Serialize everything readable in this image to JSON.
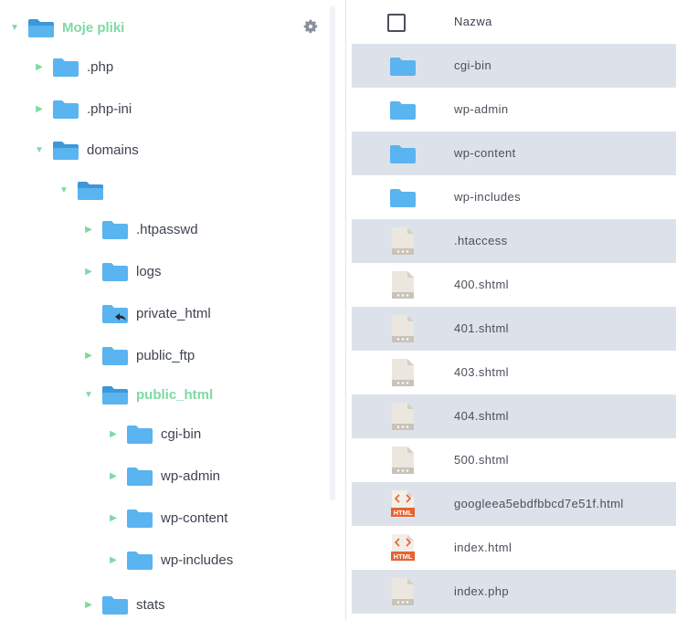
{
  "tree": {
    "root_label": "Moje pliki",
    "items": [
      {
        "label": ".php"
      },
      {
        "label": ".php-ini"
      },
      {
        "label": "domains"
      },
      {
        "label": ""
      },
      {
        "label": ".htpasswd"
      },
      {
        "label": "logs"
      },
      {
        "label": "private_html"
      },
      {
        "label": "public_ftp"
      },
      {
        "label": "public_html"
      },
      {
        "label": "cgi-bin"
      },
      {
        "label": "wp-admin"
      },
      {
        "label": "wp-content"
      },
      {
        "label": "wp-includes"
      },
      {
        "label": "stats"
      }
    ]
  },
  "list": {
    "column_name": "Nazwa",
    "files": [
      {
        "name": "cgi-bin",
        "type": "folder"
      },
      {
        "name": "wp-admin",
        "type": "folder"
      },
      {
        "name": "wp-content",
        "type": "folder"
      },
      {
        "name": "wp-includes",
        "type": "folder"
      },
      {
        "name": ".htaccess",
        "type": "file"
      },
      {
        "name": "400.shtml",
        "type": "file"
      },
      {
        "name": "401.shtml",
        "type": "file"
      },
      {
        "name": "403.shtml",
        "type": "file"
      },
      {
        "name": "404.shtml",
        "type": "file"
      },
      {
        "name": "500.shtml",
        "type": "file"
      },
      {
        "name": "googleea5ebdfbbcd7e51f.html",
        "type": "html"
      },
      {
        "name": "index.html",
        "type": "html"
      },
      {
        "name": "index.php",
        "type": "file"
      }
    ],
    "html_badge": "HTML"
  },
  "colors": {
    "accent": "#7fd9a3",
    "folder": "#5ab4f0",
    "row_shade": "#dde2ea",
    "html_badge": "#e9622f"
  }
}
